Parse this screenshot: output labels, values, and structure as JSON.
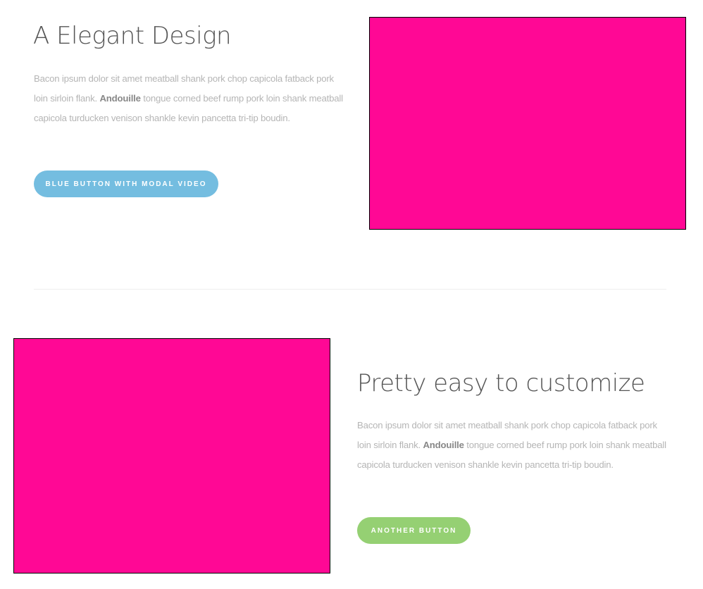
{
  "section1": {
    "title": "A Elegant Design",
    "text_before": "Bacon ipsum dolor sit amet meatball shank pork chop capicola fatback pork loin sirloin flank. ",
    "text_bold": "Andouille",
    "text_after": " tongue corned beef rump pork loin shank meatball capicola turducken venison shankle kevin pancetta tri-tip boudin.",
    "button_label": "BLUE BUTTON WITH MODAL VIDEO",
    "button_color": "#74bde0",
    "image_color": "#ff0895"
  },
  "section2": {
    "title": "Pretty easy to customize",
    "text_before": "Bacon ipsum dolor sit amet meatball shank pork chop capicola fatback pork loin sirloin flank. ",
    "text_bold": "Andouille",
    "text_after": " tongue corned beef rump pork loin shank meatball capicola turducken venison shankle kevin pancetta tri-tip boudin.",
    "button_label": "ANOTHER BUTTON",
    "button_color": "#95d073",
    "image_color": "#ff0895"
  }
}
